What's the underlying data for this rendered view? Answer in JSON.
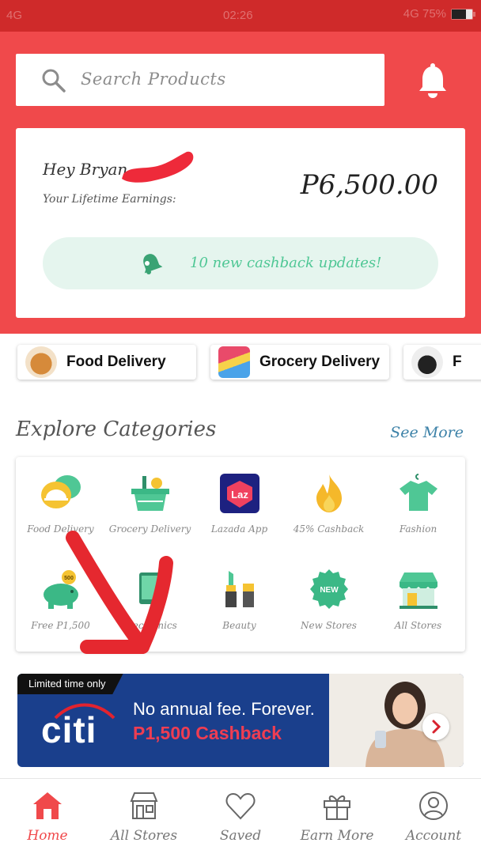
{
  "status_bar": {
    "left": "4G",
    "time": "02:26",
    "right": "4G 75%"
  },
  "search": {
    "placeholder": "Search Products"
  },
  "welcome": {
    "greeting": "Hey Bryan",
    "lifetime_label": "Your Lifetime Earnings:",
    "earnings": "P6,500.00",
    "cashback_updates": "10 new cashback updates!"
  },
  "quick_links": [
    {
      "label": "Food Delivery"
    },
    {
      "label": "Grocery Delivery"
    },
    {
      "label": "F"
    }
  ],
  "explore": {
    "title": "Explore Categories",
    "see_more": "See More",
    "categories": [
      {
        "label": "Food Delivery",
        "icon": "food-delivery-icon"
      },
      {
        "label": "Grocery Delivery",
        "icon": "grocery-basket-icon"
      },
      {
        "label": "Lazada App",
        "icon": "lazada-icon"
      },
      {
        "label": "45% Cashback",
        "icon": "flame-icon"
      },
      {
        "label": "Fashion",
        "icon": "shirt-icon"
      },
      {
        "label": "Free P1,500",
        "icon": "piggy-bank-icon"
      },
      {
        "label": "Electronics",
        "icon": "tablet-icon"
      },
      {
        "label": "Beauty",
        "icon": "lipstick-icon"
      },
      {
        "label": "New Stores",
        "icon": "new-badge-icon"
      },
      {
        "label": "All Stores",
        "icon": "storefront-icon"
      }
    ]
  },
  "banner": {
    "tag": "Limited time only",
    "brand": "citi",
    "line1": "No annual fee. Forever.",
    "line2": "P1,500 Cashback"
  },
  "bottom_nav": [
    {
      "label": "Home",
      "active": true
    },
    {
      "label": "All Stores"
    },
    {
      "label": "Saved"
    },
    {
      "label": "Earn More"
    },
    {
      "label": "Account"
    }
  ],
  "colors": {
    "brand_red": "#f0494b",
    "accent_green": "#4fc795",
    "link_blue": "#3d82a8",
    "banner_blue": "#1a3f8c"
  }
}
